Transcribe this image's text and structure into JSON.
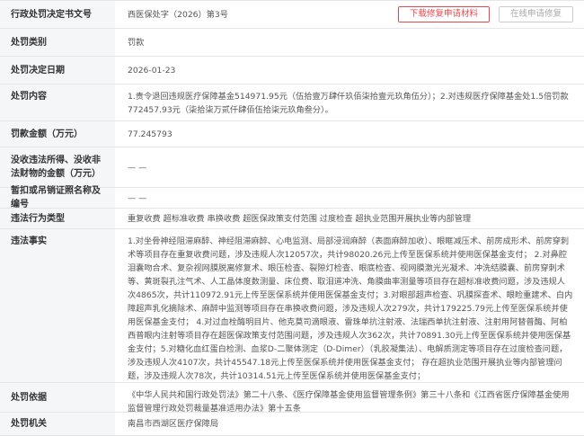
{
  "rows": {
    "doc_no": {
      "label": "行政处罚决定书文号",
      "value": "西医保处字（2026）第3号"
    },
    "category": {
      "label": "处罚类别",
      "value": "罚款"
    },
    "date": {
      "label": "处罚决定日期",
      "value": "2026-01-23"
    },
    "content": {
      "label": "处罚内容",
      "value": "1.责令退回违规医疗保障基金514971.95元（伍拾壹万肆仟玖佰柒拾壹元玖角伍分）；2.对违规医疗保障基金处1.5倍罚款772457.93元（柒拾柒万贰仟肆佰伍拾柒元玖角叁分）。"
    },
    "amount": {
      "label": "罚款金额（万元）",
      "value": "77.245793"
    },
    "confiscated": {
      "label": "没收违法所得、没收非法财物的金额（万元）",
      "value": "— —"
    },
    "license": {
      "label": "暂扣或吊销证照名称及编号",
      "value": "— —"
    },
    "violation_type": {
      "label": "违法行为类型",
      "value": "重复收费 超标准收费 串换收费 超医保政策支付范围 过度检查 超执业范围开展执业等内部管理"
    },
    "facts": {
      "label": "违法事实",
      "value": "1.对坐骨神经阻滞麻醉、神经阻滞麻醉、心电监测、局部浸润麻醉（表面麻醉加收）、眼眶减压术、前房成形术、前房穿刺术等项目存在重复收费问题，涉及违规人次12057次，共计98020.26元上传至医保系统并使用医保基金支付； 2.对鼻腔泪囊吻合术、复杂视网膜脱离修复术、眼压检查、裂隙灯检查、眼底检查、视网膜激光光凝术、冲洗结膜囊、前房穿刺术等、黄斑裂孔注气术、人工晶体度数测量、床位费、取泪道冲洗、角膜曲率测量等项目存在超标准收费问题，涉及违规人次4865次，共计110972.91元上传至医保系统并使用医保基金支付；3.对眼部超声检查、巩膜探查术、眼睑重建术、白内障超声乳化摘除术、麻醉中监测等项目存在串换收费问题，涉及违规人次279次，共计179225.79元上传至医保系统并使用医保基金支付； 4.对过血栓酶明目片、他克莫司滴眼液、雷珠单抗注射液、法瑞西单抗注射液、注射用阿替普酶、阿柏西普眼内注射等项目存在超医保政策支付范围问题，涉及违规人次362次，共计70891.30元上传至医保系统并使用医保基金支付；5.对糖化血红蛋白检测、血浆D-二聚体测定（D-Dimer）（乳胶凝集法）、电解质测定等项目存在过度检查问题，涉及违规人次4107次，共计45547.18元上传至医保系统并使用医保基金支付； 存在超执业范围开展执业等内部管理问题，涉及违规人次78次，共计10314.51元上传至医保系统并使用医保基金支付；"
    },
    "basis": {
      "label": "处罚依据",
      "value": "《中华人民共和国行政处罚法》第二十八条、《医疗保障基金使用监督管理条例》第三十八条和《江西省医疗保障基金使用监督管理行政处罚裁量基准适用办法》第十五条"
    },
    "authority": {
      "label": "处罚机关",
      "value": "南昌市西湖区医疗保障局"
    }
  },
  "actions": {
    "download_label": "下载修复申请材料",
    "online_label": "在线申请修复"
  },
  "colors": {
    "accent_red": "#e5484d",
    "label_bg": "#f5f6f8",
    "disabled": "#aaaaaa"
  }
}
